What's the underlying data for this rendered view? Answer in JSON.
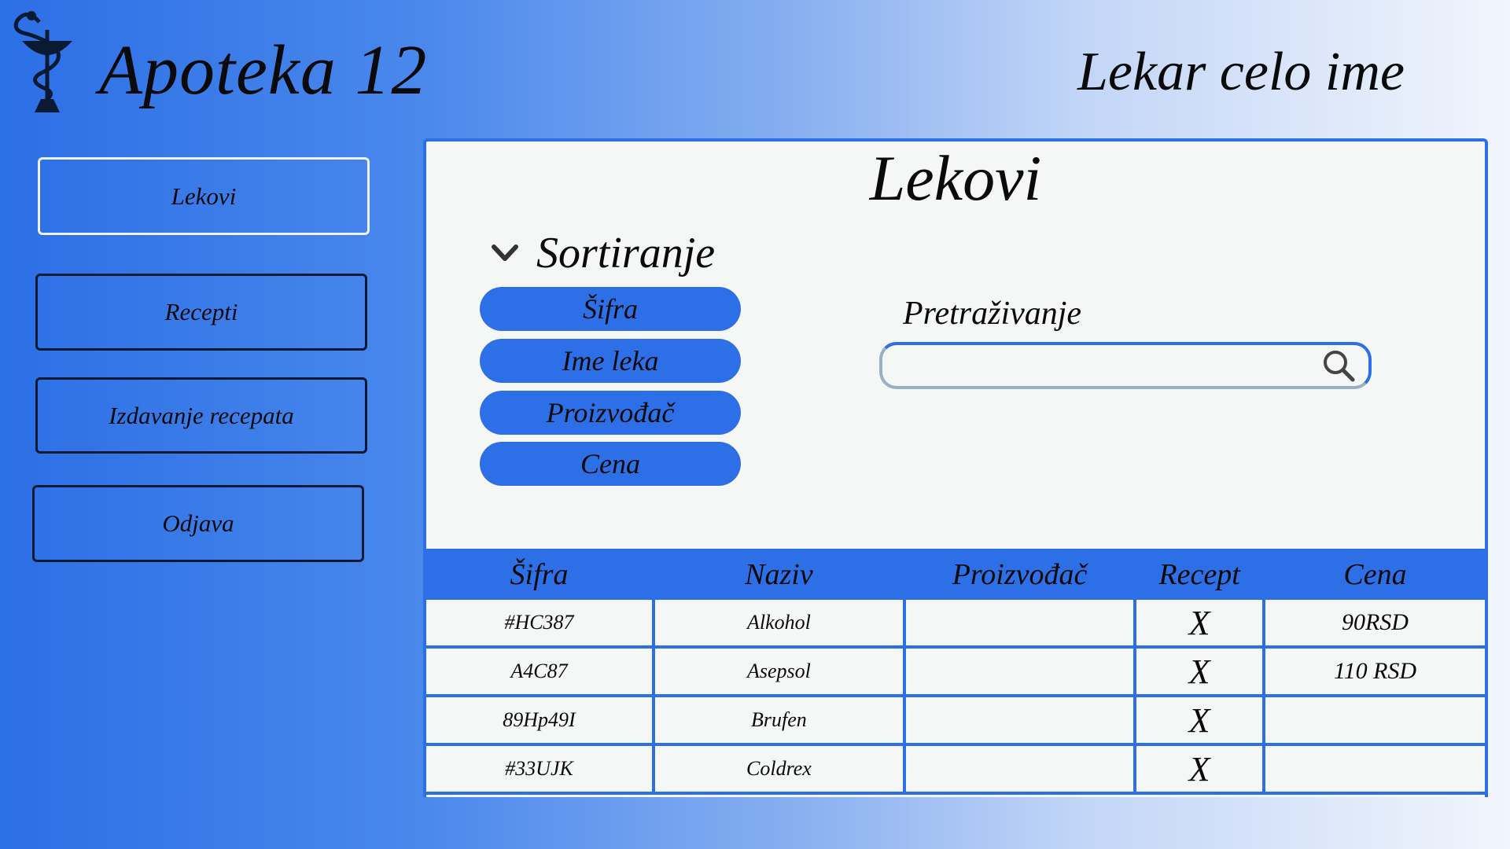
{
  "header": {
    "app_title": "Apoteka 12",
    "user_name": "Lekar celo ime"
  },
  "sidebar": {
    "items": [
      {
        "label": "Lekovi",
        "active": true
      },
      {
        "label": "Recepti",
        "active": false
      },
      {
        "label": "Izdavanje recepata",
        "active": false
      },
      {
        "label": "Odjava",
        "active": false
      }
    ]
  },
  "main": {
    "title": "Lekovi",
    "sort": {
      "label": "Sortiranje",
      "options": [
        "Šifra",
        "Ime leka",
        "Proizvođač",
        "Cena"
      ]
    },
    "search": {
      "label": "Pretraživanje",
      "value": "",
      "placeholder": ""
    },
    "table": {
      "columns": [
        "Šifra",
        "Naziv",
        "Proizvođač",
        "Recept",
        "Cena"
      ],
      "rows": [
        {
          "sifra": "#HC387",
          "naziv": "Alkohol",
          "proizvodjac": "",
          "recept": "X",
          "cena": "90RSD"
        },
        {
          "sifra": "A4C87",
          "naziv": "Asepsol",
          "proizvodjac": "",
          "recept": "X",
          "cena": "110 RSD"
        },
        {
          "sifra": "89Hp49I",
          "naziv": "Brufen",
          "proizvodjac": "",
          "recept": "X",
          "cena": ""
        },
        {
          "sifra": "#33UJK",
          "naziv": "Coldrex",
          "proizvodjac": "",
          "recept": "X",
          "cena": ""
        }
      ]
    }
  },
  "icons": {
    "logo": "bowl-of-hygieia-icon",
    "sort_toggle": "chevron-down-icon",
    "search": "search-icon"
  },
  "colors": {
    "accent": "#2c6fe6",
    "panel_bg": "#f5f7f6"
  }
}
